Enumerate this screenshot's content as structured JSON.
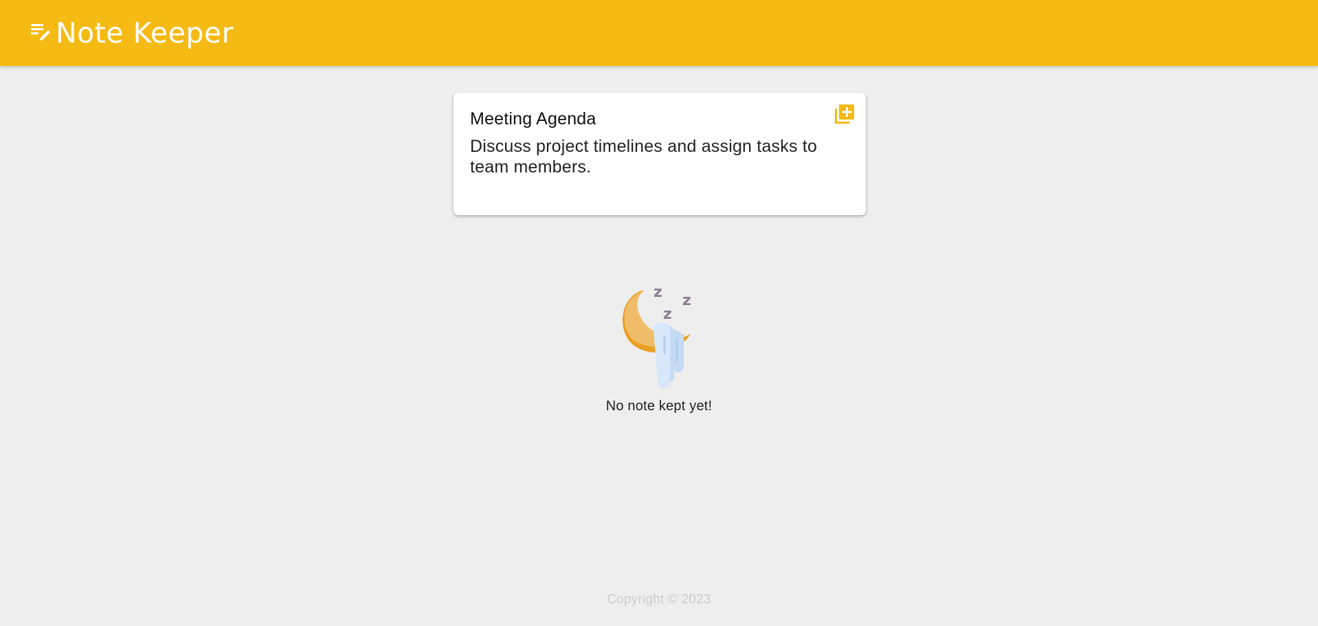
{
  "app": {
    "title": "Note Keeper",
    "brand_icon": "notes-edit-icon",
    "accent_color": "#f5ba13",
    "background_color": "#eeeeee"
  },
  "note": {
    "title": "Meeting Agenda",
    "content": "Discuss project timelines and assign tasks to team members.",
    "add_icon": "library-add-icon"
  },
  "empty_state": {
    "illustration": "sleeping-moon-icon",
    "message": "No note kept yet!"
  },
  "footer": {
    "text": "Copyright © 2023"
  }
}
